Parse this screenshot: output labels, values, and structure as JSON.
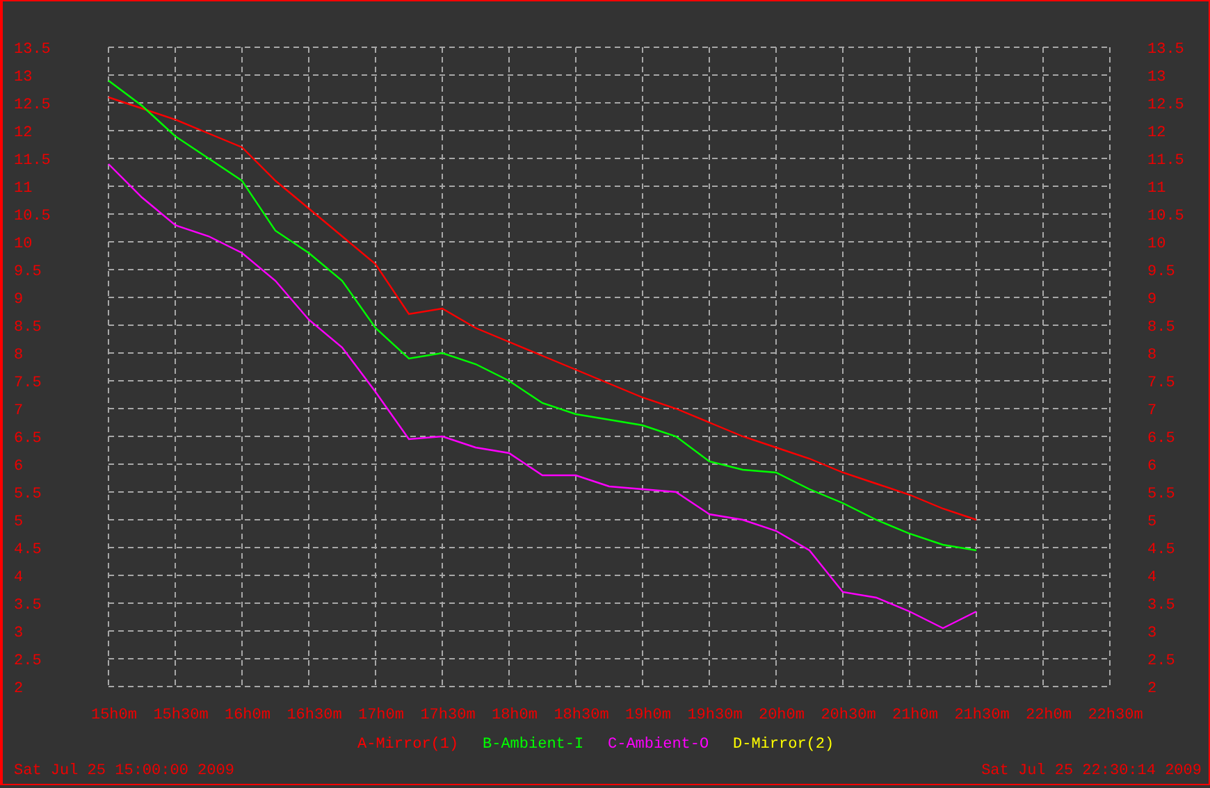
{
  "chart_data": {
    "type": "line",
    "categories": [
      "15h0m",
      null,
      "15h30m",
      null,
      "16h0m",
      null,
      "16h30m",
      null,
      "17h0m",
      null,
      "17h30m",
      null,
      "18h0m",
      null,
      "18h30m",
      null,
      "19h0m",
      null,
      "19h30m",
      null,
      "20h0m",
      null,
      "20h30m",
      null,
      "21h0m",
      null,
      "21h30m",
      null,
      "22h0m",
      null,
      "22h30m"
    ],
    "series": [
      {
        "name": "A-Mirror(1)",
        "color": "#ff0000",
        "values": [
          12.6,
          12.4,
          12.2,
          11.95,
          11.7,
          11.1,
          10.6,
          10.1,
          9.6,
          8.7,
          8.8,
          8.45,
          8.2,
          7.95,
          7.7,
          7.45,
          7.2,
          7.0,
          6.75,
          6.5,
          6.3,
          6.1,
          5.85,
          5.65,
          5.45,
          5.2,
          5.0,
          null,
          null,
          null,
          null
        ]
      },
      {
        "name": "B-Ambient-I",
        "color": "#00ff00",
        "values": [
          12.9,
          12.45,
          11.9,
          11.5,
          11.1,
          10.2,
          9.8,
          9.3,
          8.45,
          7.9,
          8.0,
          7.8,
          7.5,
          7.1,
          6.9,
          6.8,
          6.7,
          6.5,
          6.05,
          5.9,
          5.85,
          5.55,
          5.3,
          5.0,
          4.75,
          4.55,
          4.45,
          null,
          null,
          null,
          null
        ]
      },
      {
        "name": "C-Ambient-O",
        "color": "#ff00ff",
        "values": [
          11.4,
          10.8,
          10.3,
          10.1,
          9.8,
          9.3,
          8.6,
          8.1,
          7.3,
          6.45,
          6.5,
          6.3,
          6.2,
          5.8,
          5.8,
          5.6,
          5.55,
          5.5,
          5.1,
          5.0,
          4.8,
          4.45,
          3.7,
          3.6,
          3.35,
          3.05,
          3.35,
          null,
          null,
          null,
          null
        ]
      },
      {
        "name": "D-Mirror(2)",
        "color": "#ffff00",
        "values": [
          null,
          null,
          null,
          null,
          null,
          null,
          null,
          null,
          null,
          null,
          null,
          null,
          null,
          null,
          null,
          null,
          null,
          null,
          null,
          null,
          null,
          null,
          null,
          null,
          null,
          null,
          null,
          null,
          null,
          null,
          null
        ]
      }
    ],
    "ylim": [
      2,
      13.5
    ],
    "grid": true,
    "yticks": [
      {
        "value": 2,
        "label": "2"
      },
      {
        "value": 2.5,
        "label": "2.5"
      },
      {
        "value": 3,
        "label": "3"
      },
      {
        "value": 3.5,
        "label": "3.5"
      },
      {
        "value": 4,
        "label": "4"
      },
      {
        "value": 4.5,
        "label": "4.5"
      },
      {
        "value": 5,
        "label": "5"
      },
      {
        "value": 5.5,
        "label": "5.5"
      },
      {
        "value": 6,
        "label": "6"
      },
      {
        "value": 6.5,
        "label": "6.5"
      },
      {
        "value": 7,
        "label": "7"
      },
      {
        "value": 7.5,
        "label": "7.5"
      },
      {
        "value": 8,
        "label": "8"
      },
      {
        "value": 8.5,
        "label": "8.5"
      },
      {
        "value": 9,
        "label": "9"
      },
      {
        "value": 9.5,
        "label": "9.5"
      },
      {
        "value": 10,
        "label": "10"
      },
      {
        "value": 10.5,
        "label": "10.5"
      },
      {
        "value": 11,
        "label": "11"
      },
      {
        "value": 11.5,
        "label": "11.5"
      },
      {
        "value": 12,
        "label": "12"
      },
      {
        "value": 12.5,
        "label": "12.5"
      },
      {
        "value": 13,
        "label": "13"
      },
      {
        "value": 13.5,
        "label": "13.5"
      }
    ]
  },
  "right_axis_labels": [
    "13.5",
    "13",
    "12.5",
    "12",
    "11.5",
    "11",
    "10.5",
    "10",
    "9.5",
    "9",
    "8.5",
    "8",
    "7.5",
    "7",
    "6.5",
    "6",
    "5.5",
    "5",
    "4.5",
    "4",
    "3.5",
    "3",
    "2.5",
    "2"
  ],
  "footer": {
    "start_time": "Sat Jul 25 15:00:00 2009",
    "end_time": "Sat Jul 25 22:30:14 2009"
  }
}
